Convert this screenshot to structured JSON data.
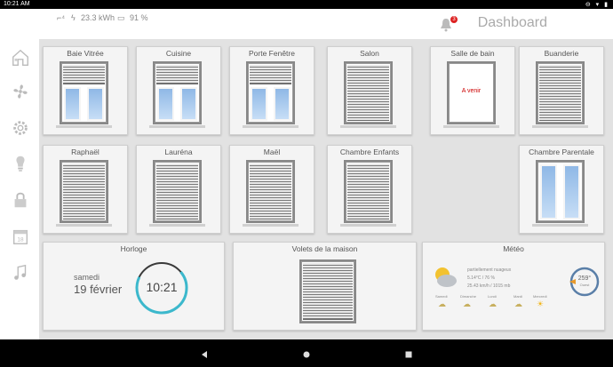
{
  "status_bar": {
    "time": "10:21 AM"
  },
  "topbar": {
    "energy": "23.3 kWh",
    "humidity": "91 %",
    "notif_count": "3",
    "title": "Dashboard"
  },
  "sidebar": [
    "home-icon",
    "fan-icon",
    "settings-icon",
    "light-bulb-icon",
    "lock-icon",
    "calendar-icon",
    "music-icon"
  ],
  "tiles": {
    "baie_vitree": "Baie Vitrée",
    "cuisine": "Cuisine",
    "porte_fenetre": "Porte Fenêtre",
    "salon": "Salon",
    "salle_de_bain": "Salle de bain",
    "salle_de_bain_note": "A venir",
    "buanderie": "Buanderie",
    "raphael": "Raphaël",
    "laurena": "Lauréna",
    "mael": "Maël",
    "chambre_enfants": "Chambre Enfants",
    "chambre_parentale": "Chambre Parentale"
  },
  "horloge": {
    "title": "Horloge",
    "day": "samedi",
    "date": "19 février",
    "time": "10:21"
  },
  "volets": {
    "title": "Volets de la maison"
  },
  "meteo": {
    "title": "Météo",
    "condition": "partiellement nuageux",
    "temp": "5.14°C / 76 %",
    "wind": "25.43 km/h / 1015 mb",
    "wind_deg": "259°",
    "wind_label": "Ouest",
    "forecast": [
      "Samedi",
      "Dimanche",
      "Lundi",
      "Mardi",
      "Mercredi"
    ]
  }
}
